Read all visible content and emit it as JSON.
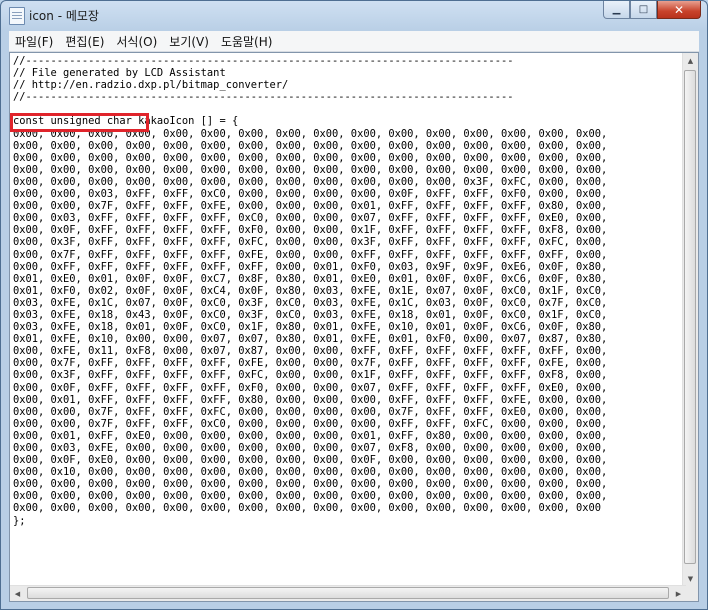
{
  "window": {
    "title": "icon - 메모장",
    "minimize_glyph": "▁",
    "maximize_glyph": "□",
    "close_glyph": "✕"
  },
  "menu": {
    "items": [
      "파일(F)",
      "편집(E)",
      "서식(O)",
      "보기(V)",
      "도움말(H)"
    ]
  },
  "document": {
    "lines": [
      "//------------------------------------------------------------------------------",
      "// File generated by LCD Assistant",
      "// http://en.radzio.dxp.pl/bitmap_converter/",
      "//------------------------------------------------------------------------------",
      "",
      "const unsigned char kakaoIcon [] = {",
      "0x00, 0x00, 0x00, 0x00, 0x00, 0x00, 0x00, 0x00, 0x00, 0x00, 0x00, 0x00, 0x00, 0x00, 0x00, 0x00,",
      "0x00, 0x00, 0x00, 0x00, 0x00, 0x00, 0x00, 0x00, 0x00, 0x00, 0x00, 0x00, 0x00, 0x00, 0x00, 0x00,",
      "0x00, 0x00, 0x00, 0x00, 0x00, 0x00, 0x00, 0x00, 0x00, 0x00, 0x00, 0x00, 0x00, 0x00, 0x00, 0x00,",
      "0x00, 0x00, 0x00, 0x00, 0x00, 0x00, 0x00, 0x00, 0x00, 0x00, 0x00, 0x00, 0x00, 0x00, 0x00, 0x00,",
      "0x00, 0x00, 0x00, 0x00, 0x00, 0x00, 0x00, 0x00, 0x00, 0x00, 0x00, 0x00, 0x3F, 0xFC, 0x00, 0x00,",
      "0x00, 0x00, 0x03, 0xFF, 0xFF, 0xC0, 0x00, 0x00, 0x00, 0x00, 0x0F, 0xFF, 0xFF, 0xF0, 0x00, 0x00,",
      "0x00, 0x00, 0x7F, 0xFF, 0xFF, 0xFE, 0x00, 0x00, 0x00, 0x01, 0xFF, 0xFF, 0xFF, 0xFF, 0x80, 0x00,",
      "0x00, 0x03, 0xFF, 0xFF, 0xFF, 0xFF, 0xC0, 0x00, 0x00, 0x07, 0xFF, 0xFF, 0xFF, 0xFF, 0xE0, 0x00,",
      "0x00, 0x0F, 0xFF, 0xFF, 0xFF, 0xFF, 0xF0, 0x00, 0x00, 0x1F, 0xFF, 0xFF, 0xFF, 0xFF, 0xF8, 0x00,",
      "0x00, 0x3F, 0xFF, 0xFF, 0xFF, 0xFF, 0xFC, 0x00, 0x00, 0x3F, 0xFF, 0xFF, 0xFF, 0xFF, 0xFC, 0x00,",
      "0x00, 0x7F, 0xFF, 0xFF, 0xFF, 0xFF, 0xFE, 0x00, 0x00, 0xFF, 0xFF, 0xFF, 0xFF, 0xFF, 0xFF, 0x00,",
      "0x00, 0xFF, 0xFF, 0xFF, 0xFF, 0xFF, 0xFF, 0x00, 0x01, 0xF0, 0x03, 0x9F, 0x9F, 0xE6, 0x0F, 0x80,",
      "0x01, 0xE0, 0x01, 0x0F, 0x0F, 0xC7, 0x8F, 0x80, 0x01, 0xE0, 0x01, 0x0F, 0x0F, 0xC6, 0x0F, 0x80,",
      "0x01, 0xF0, 0x02, 0x0F, 0x0F, 0xC4, 0x0F, 0x80, 0x03, 0xFE, 0x1E, 0x07, 0x0F, 0xC0, 0x1F, 0xC0,",
      "0x03, 0xFE, 0x1C, 0x07, 0x0F, 0xC0, 0x3F, 0xC0, 0x03, 0xFE, 0x1C, 0x03, 0x0F, 0xC0, 0x7F, 0xC0,",
      "0x03, 0xFE, 0x18, 0x43, 0x0F, 0xC0, 0x3F, 0xC0, 0x03, 0xFE, 0x18, 0x01, 0x0F, 0xC0, 0x1F, 0xC0,",
      "0x03, 0xFE, 0x18, 0x01, 0x0F, 0xC0, 0x1F, 0x80, 0x01, 0xFE, 0x10, 0x01, 0x0F, 0xC6, 0x0F, 0x80,",
      "0x01, 0xFE, 0x10, 0x00, 0x00, 0x07, 0x07, 0x80, 0x01, 0xFE, 0x01, 0xF0, 0x00, 0x07, 0x87, 0x80,",
      "0x00, 0xFE, 0x11, 0xF8, 0x00, 0x07, 0x87, 0x00, 0x00, 0xFF, 0xFF, 0xFF, 0xFF, 0xFF, 0xFF, 0x00,",
      "0x00, 0x7F, 0xFF, 0xFF, 0xFF, 0xFF, 0xFE, 0x00, 0x00, 0x7F, 0xFF, 0xFF, 0xFF, 0xFF, 0xFE, 0x00,",
      "0x00, 0x3F, 0xFF, 0xFF, 0xFF, 0xFF, 0xFC, 0x00, 0x00, 0x1F, 0xFF, 0xFF, 0xFF, 0xFF, 0xF8, 0x00,",
      "0x00, 0x0F, 0xFF, 0xFF, 0xFF, 0xFF, 0xF0, 0x00, 0x00, 0x07, 0xFF, 0xFF, 0xFF, 0xFF, 0xE0, 0x00,",
      "0x00, 0x01, 0xFF, 0xFF, 0xFF, 0xFF, 0x80, 0x00, 0x00, 0x00, 0xFF, 0xFF, 0xFF, 0xFE, 0x00, 0x00,",
      "0x00, 0x00, 0x7F, 0xFF, 0xFF, 0xFC, 0x00, 0x00, 0x00, 0x00, 0x7F, 0xFF, 0xFF, 0xE0, 0x00, 0x00,",
      "0x00, 0x00, 0x7F, 0xFF, 0xFF, 0xC0, 0x00, 0x00, 0x00, 0x00, 0xFF, 0xFF, 0xFC, 0x00, 0x00, 0x00,",
      "0x00, 0x01, 0xFF, 0xE0, 0x00, 0x00, 0x00, 0x00, 0x00, 0x01, 0xFF, 0x80, 0x00, 0x00, 0x00, 0x00,",
      "0x00, 0x03, 0xFE, 0x00, 0x00, 0x00, 0x00, 0x00, 0x00, 0x07, 0xF8, 0x00, 0x00, 0x00, 0x00, 0x00,",
      "0x00, 0x0F, 0xE0, 0x00, 0x00, 0x00, 0x00, 0x00, 0x00, 0x0F, 0x00, 0x00, 0x00, 0x00, 0x00, 0x00,",
      "0x00, 0x10, 0x00, 0x00, 0x00, 0x00, 0x00, 0x00, 0x00, 0x00, 0x00, 0x00, 0x00, 0x00, 0x00, 0x00,",
      "0x00, 0x00, 0x00, 0x00, 0x00, 0x00, 0x00, 0x00, 0x00, 0x00, 0x00, 0x00, 0x00, 0x00, 0x00, 0x00,",
      "0x00, 0x00, 0x00, 0x00, 0x00, 0x00, 0x00, 0x00, 0x00, 0x00, 0x00, 0x00, 0x00, 0x00, 0x00, 0x00,",
      "0x00, 0x00, 0x00, 0x00, 0x00, 0x00, 0x00, 0x00, 0x00, 0x00, 0x00, 0x00, 0x00, 0x00, 0x00, 0x00",
      "};"
    ]
  },
  "annotation": {
    "highlighted_text": "const unsigned char",
    "color": "#e0242b"
  },
  "scrollbars": {
    "up_glyph": "▲",
    "down_glyph": "▼",
    "left_glyph": "◀",
    "right_glyph": "▶"
  }
}
